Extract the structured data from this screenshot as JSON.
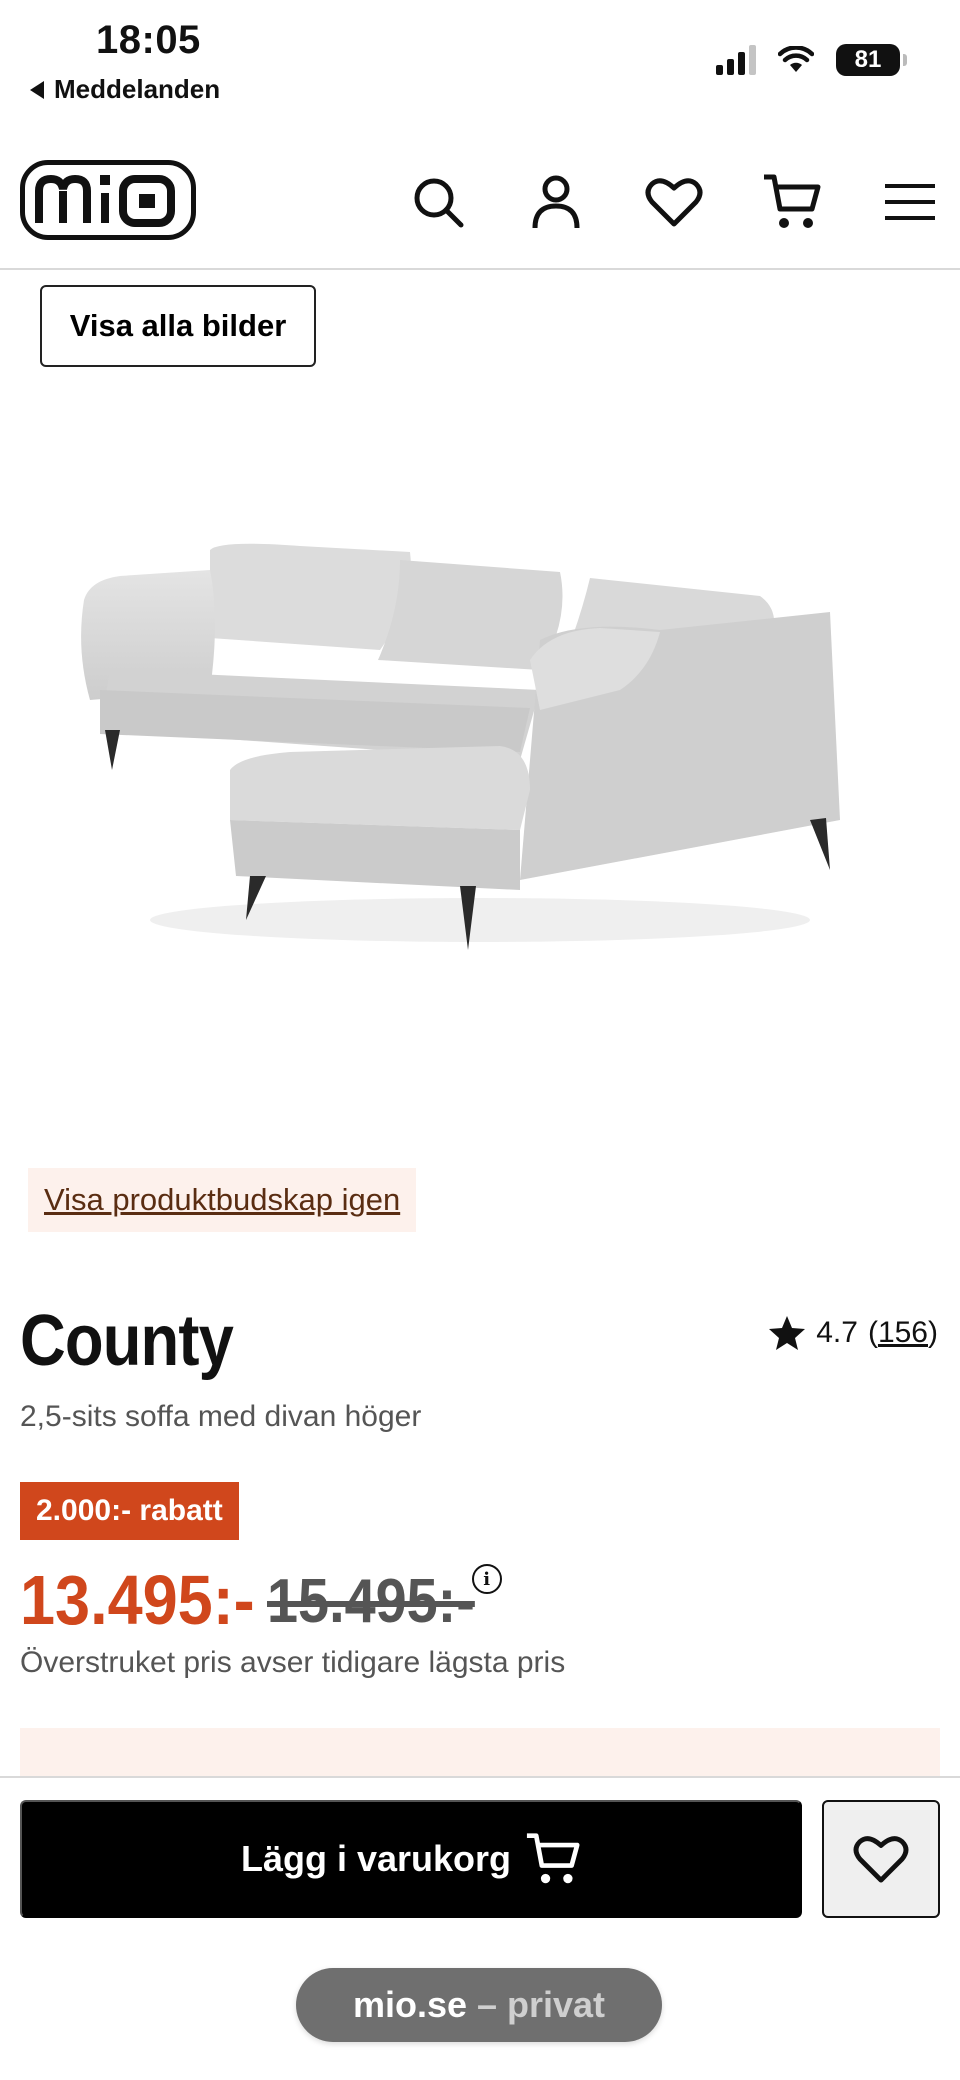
{
  "status_bar": {
    "time": "18:05",
    "back_label": "Meddelanden",
    "battery": "81"
  },
  "header": {
    "logo_text": "mio",
    "icons": [
      "search-icon",
      "account-icon",
      "heart-icon",
      "cart-icon",
      "menu-icon"
    ]
  },
  "gallery": {
    "show_all_images_label": "Visa alla bilder"
  },
  "product_message_link": "Visa produktbudskap igen",
  "product": {
    "title": "County",
    "subtitle": "2,5-sits soffa med divan höger",
    "rating": "4.7",
    "review_count": "156",
    "discount_badge": "2.000:- rabatt",
    "price": "13.495:-",
    "old_price": "15.495:-",
    "price_note": "Överstruket pris avser tidigare lägsta pris"
  },
  "sticky_bar": {
    "add_to_cart_label": "Lägg i varukorg"
  },
  "browser": {
    "domain": "mio.se",
    "mode": "– privat"
  },
  "colors": {
    "accent": "#d0471c",
    "promo_background": "#fdf1ec",
    "button_dark": "#000000"
  }
}
